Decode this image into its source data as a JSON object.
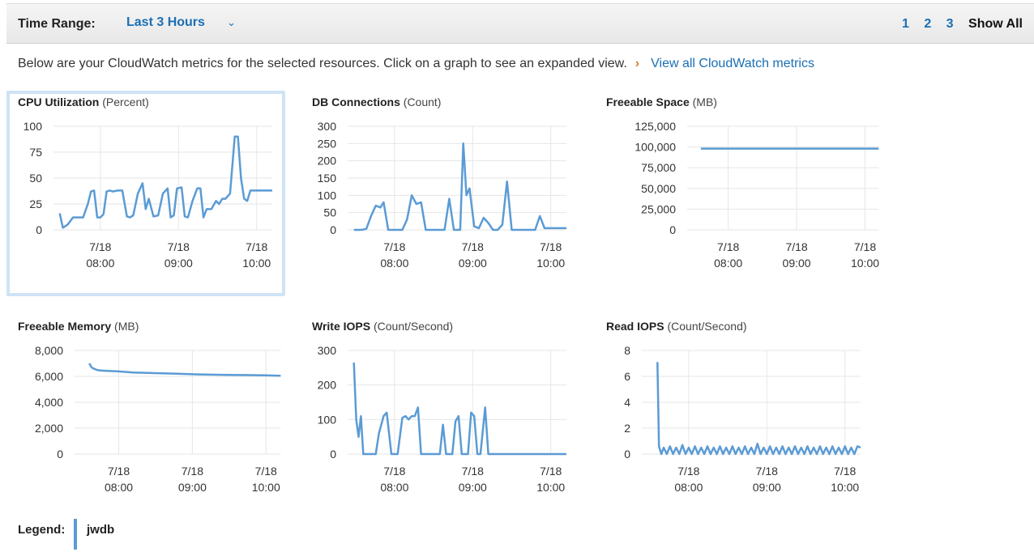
{
  "toolbar": {
    "time_range_label": "Time Range:",
    "time_range_value": "Last 3 Hours",
    "pages": [
      "1",
      "2",
      "3"
    ],
    "show_all": "Show All"
  },
  "intro": {
    "text": "Below are your CloudWatch metrics for the selected resources. Click on a graph to see an expanded view.",
    "separator": "›",
    "link": "View all CloudWatch metrics"
  },
  "legend": {
    "label": "Legend:",
    "name": "jwdb",
    "color": "#5b9bd5"
  },
  "colors": {
    "line": "#5b9bd5",
    "grid": "#e6e6e6",
    "link": "#1a6fb4",
    "selected_border": "#cfe3f5"
  },
  "chart_data": [
    {
      "type": "line",
      "title": "CPU Utilization",
      "unit": "(Percent)",
      "yticks": [
        "100",
        "75",
        "50",
        "25",
        "0"
      ],
      "ylim": [
        0,
        100
      ],
      "xticks": [
        [
          "7/18",
          "08:00"
        ],
        [
          "7/18",
          "09:00"
        ],
        [
          "7/18",
          "10:00"
        ]
      ],
      "xlim": [
        7.4,
        10.2
      ],
      "xtick_values": [
        8,
        9,
        10
      ],
      "series": [
        {
          "x": [
            7.48,
            7.52,
            7.58,
            7.65,
            7.72,
            7.78,
            7.84,
            7.88,
            7.92,
            7.96,
            8.0,
            8.04,
            8.08,
            8.12,
            8.16,
            8.22,
            8.28,
            8.34,
            8.38,
            8.42,
            8.48,
            8.54,
            8.58,
            8.62,
            8.68,
            8.74,
            8.8,
            8.86,
            8.9,
            8.94,
            8.98,
            9.04,
            9.08,
            9.12,
            9.18,
            9.24,
            9.28,
            9.32,
            9.36,
            9.42,
            9.48,
            9.52,
            9.56,
            9.6,
            9.66,
            9.72,
            9.76,
            9.8,
            9.84,
            9.88,
            9.92,
            9.96,
            10.0,
            10.04,
            10.08,
            10.12,
            10.16,
            10.2
          ],
          "y": [
            16,
            2,
            5,
            12,
            12,
            12,
            25,
            37,
            38,
            12,
            12,
            15,
            37,
            38,
            37,
            38,
            38,
            13,
            12,
            14,
            35,
            45,
            20,
            30,
            13,
            14,
            35,
            40,
            12,
            14,
            40,
            41,
            13,
            12,
            28,
            40,
            40,
            12,
            20,
            20,
            28,
            25,
            30,
            30,
            35,
            90,
            90,
            50,
            30,
            28,
            38,
            38,
            38,
            38,
            38,
            38,
            38,
            38
          ]
        }
      ]
    },
    {
      "type": "line",
      "title": "DB Connections",
      "unit": "(Count)",
      "yticks": [
        "300",
        "250",
        "200",
        "150",
        "100",
        "50",
        "0"
      ],
      "ylim": [
        0,
        300
      ],
      "xticks": [
        [
          "7/18",
          "08:00"
        ],
        [
          "7/18",
          "09:00"
        ],
        [
          "7/18",
          "10:00"
        ]
      ],
      "xlim": [
        7.4,
        10.2
      ],
      "xtick_values": [
        8,
        9,
        10
      ],
      "series": [
        {
          "x": [
            7.48,
            7.58,
            7.64,
            7.7,
            7.76,
            7.82,
            7.86,
            7.92,
            7.98,
            8.04,
            8.1,
            8.16,
            8.22,
            8.28,
            8.34,
            8.4,
            8.46,
            8.52,
            8.58,
            8.64,
            8.7,
            8.76,
            8.8,
            8.84,
            8.88,
            8.92,
            8.96,
            9.02,
            9.08,
            9.14,
            9.2,
            9.26,
            9.32,
            9.38,
            9.44,
            9.5,
            9.56,
            9.62,
            9.68,
            9.74,
            9.8,
            9.86,
            9.92,
            9.98,
            10.04,
            10.1,
            10.16,
            10.2
          ],
          "y": [
            0,
            0,
            3,
            40,
            70,
            65,
            80,
            0,
            0,
            0,
            0,
            30,
            100,
            75,
            80,
            0,
            0,
            0,
            0,
            0,
            90,
            0,
            0,
            0,
            250,
            100,
            120,
            10,
            5,
            35,
            20,
            0,
            0,
            15,
            140,
            0,
            0,
            0,
            0,
            0,
            0,
            40,
            5,
            5,
            5,
            5,
            5,
            5
          ]
        }
      ]
    },
    {
      "type": "line",
      "title": "Freeable Space",
      "unit": "(MB)",
      "yticks": [
        "125,000",
        "100,000",
        "75,000",
        "50,000",
        "25,000",
        "0"
      ],
      "ylim": [
        0,
        125000
      ],
      "xticks": [
        [
          "7/18",
          "08:00"
        ],
        [
          "7/18",
          "09:00"
        ],
        [
          "7/18",
          "10:00"
        ]
      ],
      "xlim": [
        7.4,
        10.2
      ],
      "xtick_values": [
        8,
        9,
        10
      ],
      "series": [
        {
          "x": [
            7.6,
            10.2
          ],
          "y": [
            98000,
            98000
          ]
        }
      ]
    },
    {
      "type": "line",
      "title": "Freeable Memory",
      "unit": "(MB)",
      "yticks": [
        "8,000",
        "6,000",
        "4,000",
        "2,000",
        "0"
      ],
      "ylim": [
        0,
        8000
      ],
      "xticks": [
        [
          "7/18",
          "08:00"
        ],
        [
          "7/18",
          "09:00"
        ],
        [
          "7/18",
          "10:00"
        ]
      ],
      "xlim": [
        7.4,
        10.2
      ],
      "xtick_values": [
        8,
        9,
        10
      ],
      "series": [
        {
          "x": [
            7.6,
            7.63,
            7.66,
            7.7,
            7.75,
            7.85,
            8.0,
            8.2,
            8.5,
            8.8,
            9.1,
            9.4,
            9.7,
            10.0,
            10.2
          ],
          "y": [
            7000,
            6700,
            6600,
            6500,
            6450,
            6420,
            6380,
            6300,
            6250,
            6200,
            6150,
            6120,
            6100,
            6080,
            6050
          ]
        }
      ]
    },
    {
      "type": "line",
      "title": "Write IOPS",
      "unit": "(Count/Second)",
      "yticks": [
        "300",
        "200",
        "100",
        "0"
      ],
      "ylim": [
        0,
        300
      ],
      "xticks": [
        [
          "7/18",
          "08:00"
        ],
        [
          "7/18",
          "09:00"
        ],
        [
          "7/18",
          "10:00"
        ]
      ],
      "xlim": [
        7.4,
        10.2
      ],
      "xtick_values": [
        8,
        9,
        10
      ],
      "series": [
        {
          "x": [
            7.48,
            7.51,
            7.54,
            7.57,
            7.6,
            7.64,
            7.7,
            7.76,
            7.8,
            7.86,
            7.9,
            7.96,
            8.0,
            8.04,
            8.1,
            8.14,
            8.18,
            8.22,
            8.26,
            8.3,
            8.34,
            8.38,
            8.44,
            8.48,
            8.52,
            8.58,
            8.62,
            8.66,
            8.7,
            8.74,
            8.78,
            8.82,
            8.86,
            8.9,
            8.94,
            8.98,
            9.02,
            9.06,
            9.1,
            9.16,
            9.2,
            9.26,
            9.3,
            9.36,
            9.42,
            9.48,
            9.54,
            9.6,
            9.66,
            9.72,
            9.78,
            9.84,
            9.9,
            9.94,
            9.98,
            10.02,
            10.06,
            10.12,
            10.2
          ],
          "y": [
            265,
            100,
            50,
            110,
            0,
            0,
            0,
            0,
            60,
            110,
            120,
            0,
            0,
            0,
            105,
            110,
            100,
            110,
            110,
            135,
            0,
            0,
            0,
            0,
            0,
            0,
            85,
            0,
            0,
            0,
            95,
            110,
            0,
            0,
            0,
            120,
            110,
            0,
            0,
            135,
            0,
            0,
            0,
            0,
            0,
            0,
            0,
            0,
            0,
            0,
            0,
            0,
            0,
            0,
            0,
            0,
            0,
            0,
            0
          ]
        }
      ]
    },
    {
      "type": "line",
      "title": "Read IOPS",
      "unit": "(Count/Second)",
      "yticks": [
        "8",
        "6",
        "4",
        "2",
        "0"
      ],
      "ylim": [
        0,
        8
      ],
      "xticks": [
        [
          "7/18",
          "08:00"
        ],
        [
          "7/18",
          "09:00"
        ],
        [
          "7/18",
          "10:00"
        ]
      ],
      "xlim": [
        7.4,
        10.2
      ],
      "xtick_values": [
        8,
        9,
        10
      ],
      "series": [
        {
          "x": [
            7.6,
            7.62,
            7.65,
            7.68,
            7.72,
            7.76,
            7.8,
            7.84,
            7.88,
            7.92,
            7.96,
            8.0,
            8.04,
            8.08,
            8.12,
            8.16,
            8.2,
            8.24,
            8.28,
            8.32,
            8.36,
            8.4,
            8.44,
            8.48,
            8.52,
            8.56,
            8.6,
            8.64,
            8.68,
            8.72,
            8.76,
            8.8,
            8.84,
            8.88,
            8.92,
            8.96,
            9.0,
            9.04,
            9.08,
            9.12,
            9.16,
            9.2,
            9.24,
            9.28,
            9.32,
            9.36,
            9.4,
            9.44,
            9.48,
            9.52,
            9.56,
            9.6,
            9.64,
            9.68,
            9.72,
            9.76,
            9.8,
            9.84,
            9.88,
            9.92,
            9.96,
            10.0,
            10.04,
            10.08,
            10.12,
            10.16,
            10.2
          ],
          "y": [
            7.1,
            0.6,
            0,
            0.5,
            0,
            0.6,
            0,
            0.5,
            0,
            0.7,
            0,
            0.5,
            0,
            0.6,
            0,
            0.5,
            0,
            0.6,
            0,
            0.5,
            0,
            0.6,
            0,
            0.5,
            0,
            0.6,
            0,
            0.5,
            0,
            0.6,
            0,
            0.5,
            0,
            0.8,
            0,
            0.5,
            0,
            0.6,
            0,
            0.5,
            0,
            0.6,
            0,
            0.5,
            0,
            0.6,
            0,
            0.5,
            0,
            0.6,
            0,
            0.5,
            0,
            0.6,
            0,
            0.5,
            0,
            0.6,
            0,
            0.5,
            0,
            0.6,
            0,
            0.5,
            0,
            0.6,
            0.5
          ]
        }
      ]
    }
  ]
}
